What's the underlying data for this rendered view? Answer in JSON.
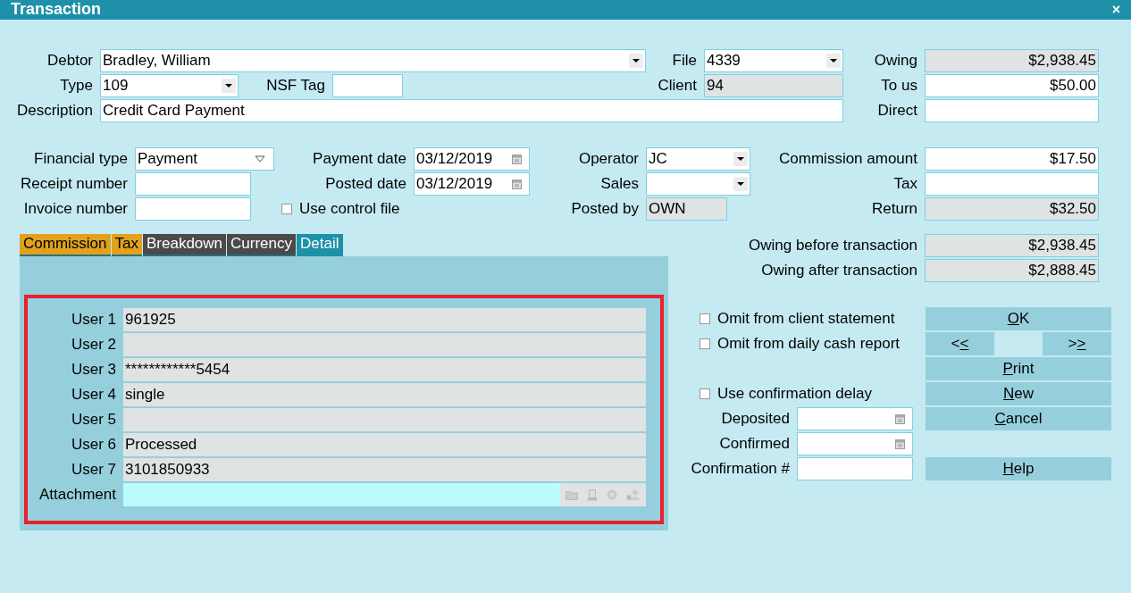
{
  "window": {
    "title": "Transaction",
    "close": "×"
  },
  "header": {
    "debtor": {
      "label": "Debtor",
      "value": "Bradley, William",
      "kind": "dropdown",
      "readonly": false
    },
    "file": {
      "label": "File",
      "value": "4339",
      "kind": "dropdown",
      "readonly": false
    },
    "owing": {
      "label": "Owing",
      "value": "$2,938.45",
      "kind": "amount",
      "readonly": true
    },
    "type": {
      "label": "Type",
      "value": "109",
      "kind": "dropdown",
      "readonly": false
    },
    "nsf_tag": {
      "label": "NSF Tag",
      "readonly": false
    },
    "client": {
      "label": "Client",
      "value": "94",
      "readonly": true
    },
    "to_us": {
      "label": "To us",
      "value": "$50.00",
      "kind": "amount",
      "readonly": false
    },
    "description": {
      "label": "Description",
      "value": "Credit Card Payment",
      "readonly": false
    },
    "direct": {
      "label": "Direct",
      "readonly": false
    }
  },
  "financial": {
    "financial_type": {
      "label": "Financial type",
      "value": "Payment",
      "kind": "list",
      "readonly": false
    },
    "payment_date": {
      "label": "Payment date",
      "value": "03/12/2019",
      "kind": "date",
      "readonly": false
    },
    "operator": {
      "label": "Operator",
      "value": "JC",
      "kind": "dropdown",
      "readonly": false
    },
    "commission_amount": {
      "label": "Commission amount",
      "value": "$17.50",
      "kind": "amount",
      "readonly": false
    },
    "receipt_number": {
      "label": "Receipt number",
      "readonly": false
    },
    "posted_date": {
      "label": "Posted date",
      "value": "03/12/2019",
      "kind": "date",
      "readonly": false
    },
    "sales": {
      "label": "Sales",
      "kind": "dropdown",
      "readonly": false
    },
    "tax": {
      "label": "Tax",
      "readonly": false
    },
    "invoice_number": {
      "label": "Invoice number",
      "readonly": false
    },
    "use_control_file": {
      "label": "Use control file",
      "checked": false
    },
    "posted_by": {
      "label": "Posted by",
      "value": "OWN",
      "readonly": true
    },
    "return": {
      "label": "Return",
      "value": "$32.50",
      "kind": "amount",
      "readonly": true
    }
  },
  "tabs": [
    {
      "label": "Commission",
      "color": "#e0a21c",
      "selected": false
    },
    {
      "label": "Tax",
      "color": "#e0a21c",
      "selected": false
    },
    {
      "label": "Breakdown",
      "color": "#4a4a4a",
      "selected": false
    },
    {
      "label": "Currency",
      "color": "#4a4a4a",
      "selected": false
    },
    {
      "label": "Detail",
      "color": "#1e91a8",
      "selected": true
    }
  ],
  "detail_fields": [
    {
      "label": "User 1",
      "value": "961925"
    },
    {
      "label": "User 2"
    },
    {
      "label": "User 3",
      "value": "************5454"
    },
    {
      "label": "User 4",
      "value": "single"
    },
    {
      "label": "User 5"
    },
    {
      "label": "User 6",
      "value": "Processed"
    },
    {
      "label": "User 7",
      "value": "3101850933"
    }
  ],
  "attachment": {
    "label": "Attachment"
  },
  "totals": [
    {
      "label": "Owing before transaction",
      "value": "$2,938.45",
      "kind": "amount",
      "readonly": true
    },
    {
      "label": "Owing after transaction",
      "value": "$2,888.45",
      "kind": "amount",
      "readonly": true
    }
  ],
  "options": [
    {
      "label": "Omit from client statement",
      "checked": false
    },
    {
      "label": "Omit from daily cash report",
      "checked": false
    },
    {
      "label": "Use confirmation delay",
      "checked": false
    }
  ],
  "confirmation": [
    {
      "label": "Deposited",
      "kind": "date",
      "readonly": false
    },
    {
      "label": "Confirmed",
      "kind": "date",
      "readonly": false
    },
    {
      "label": "Confirmation #",
      "kind": "text",
      "readonly": false
    }
  ],
  "buttons": [
    {
      "key": "O",
      "after": "K"
    },
    {
      "before": "<",
      "key": "<"
    },
    {
      "before": ">",
      "key": ">"
    },
    {
      "key": "P",
      "after": "rint"
    },
    {
      "key": "N",
      "after": "ew"
    },
    {
      "key": "C",
      "after": "ancel"
    },
    {
      "key": "H",
      "after": "elp"
    }
  ]
}
